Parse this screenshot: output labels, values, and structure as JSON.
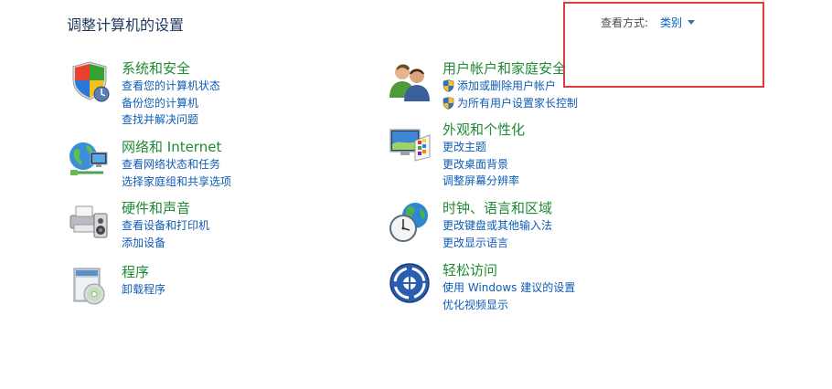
{
  "page": {
    "title": "调整计算机的设置"
  },
  "view_by": {
    "label": "查看方式:",
    "value": "类别"
  },
  "categories": [
    {
      "title": "系统和安全",
      "icon": "shield-flag-icon",
      "links": [
        "查看您的计算机状态",
        "备份您的计算机",
        "查找并解决问题"
      ]
    },
    {
      "title": "网络和 Internet",
      "icon": "network-globe-icon",
      "links": [
        "查看网络状态和任务",
        "选择家庭组和共享选项"
      ]
    },
    {
      "title": "硬件和声音",
      "icon": "printer-speaker-icon",
      "links": [
        "查看设备和打印机",
        "添加设备"
      ]
    },
    {
      "title": "程序",
      "icon": "programs-disc-icon",
      "links": [
        "卸载程序"
      ]
    },
    {
      "title": "用户帐户和家庭安全",
      "icon": "users-icon",
      "links": [
        "添加或删除用户帐户",
        "为所有用户设置家长控制"
      ],
      "links_have_shield": true
    },
    {
      "title": "外观和个性化",
      "icon": "monitor-palette-icon",
      "links": [
        "更改主题",
        "更改桌面背景",
        "调整屏幕分辨率"
      ]
    },
    {
      "title": "时钟、语言和区域",
      "icon": "clock-globe-icon",
      "links": [
        "更改键盘或其他输入法",
        "更改显示语言"
      ]
    },
    {
      "title": "轻松访问",
      "icon": "ease-of-access-icon",
      "links": [
        "使用 Windows 建议的设置",
        "优化视频显示"
      ]
    }
  ]
}
